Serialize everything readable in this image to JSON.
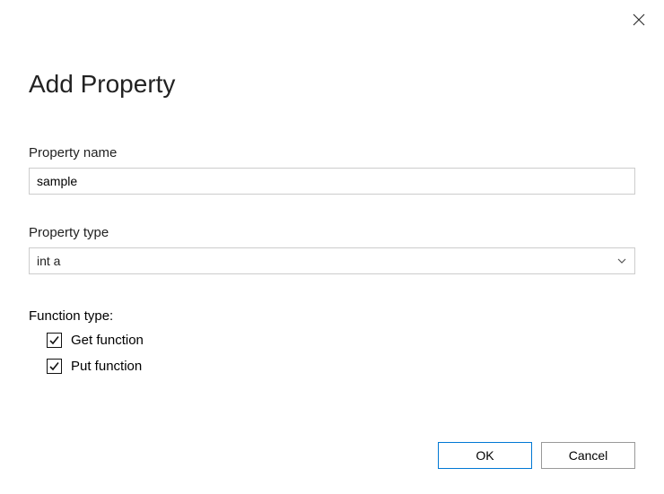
{
  "title": "Add Property",
  "property_name": {
    "label": "Property name",
    "value": "sample"
  },
  "property_type": {
    "label": "Property type",
    "selected": "int a"
  },
  "function_type": {
    "label": "Function type:",
    "get": {
      "label": "Get function",
      "checked": true
    },
    "put": {
      "label": "Put function",
      "checked": true
    }
  },
  "buttons": {
    "ok": "OK",
    "cancel": "Cancel"
  }
}
